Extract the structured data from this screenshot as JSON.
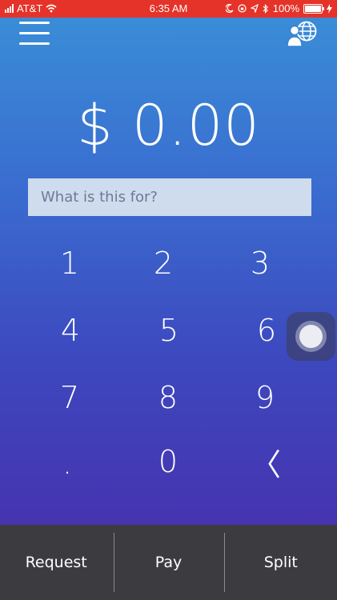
{
  "status_bar": {
    "carrier": "AT&T",
    "time": "6:35 AM",
    "battery_percent": "100%",
    "icons": [
      "signal-icon",
      "wifi-icon",
      "moon-icon",
      "lock-rotation-icon",
      "location-icon",
      "bluetooth-icon",
      "battery-icon",
      "charging-icon"
    ]
  },
  "header": {
    "menu_icon": "hamburger-menu-icon",
    "profile_icon": "user-globe-icon"
  },
  "amount": {
    "display": "$ 0.00"
  },
  "memo": {
    "placeholder": "What is this for?",
    "value": ""
  },
  "keypad": {
    "keys": [
      "1",
      "2",
      "3",
      "4",
      "5",
      "6",
      "7",
      "8",
      "9",
      ".",
      "0",
      "〈"
    ]
  },
  "actions": {
    "request": "Request",
    "pay": "Pay",
    "split": "Split"
  },
  "colors": {
    "status_bar": "#e5332a",
    "gradient_top": "#3a90d8",
    "gradient_bottom": "#4a2aa8",
    "memo_bg": "#cfdcee",
    "action_bar": "#3c3c40"
  }
}
